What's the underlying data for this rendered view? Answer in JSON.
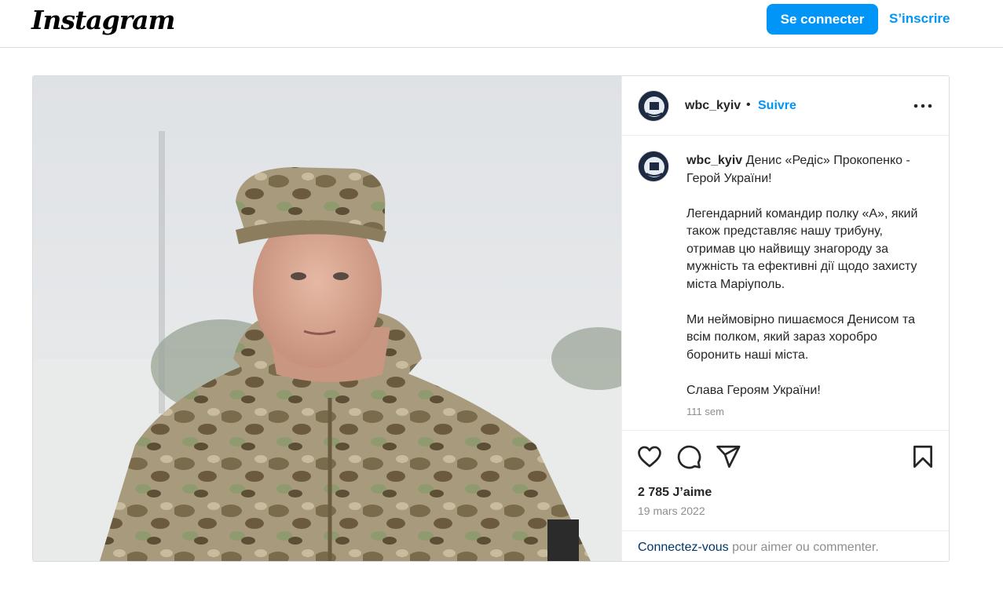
{
  "header": {
    "logo": "Instagram",
    "login_label": "Se connecter",
    "signup_label": "S’inscrire"
  },
  "post": {
    "username": "wbc_kyiv",
    "separator": "•",
    "follow_label": "Suivre",
    "caption_username": "wbc_kyiv",
    "caption_text": " Денис «Редіс» Прокопенко - Герой України!\n\nЛегендарний командир полку «А», який також представляє нашу трибуну, отримав цю найвищу знагороду за мужність та ефективні дії щодо захисту міста Маріуполь.\n\nМи неймовірно пишаємося Денисом та всім полком, який зараз хоробро боронить наші міста.\n\nСлава Героям України!",
    "time_ago": "111 sem",
    "likes": "2 785 J’aime",
    "date": "19 mars 2022",
    "login_prompt_link": "Connectez-vous",
    "login_prompt_rest": " pour aimer ou commenter."
  },
  "icons": [
    "more-options-icon",
    "heart-icon",
    "comment-icon",
    "share-icon",
    "bookmark-icon"
  ],
  "colors": {
    "accent": "#0095f6",
    "link_dark": "#00376b",
    "muted": "#8e8e8e",
    "border": "#dbdbdb"
  }
}
